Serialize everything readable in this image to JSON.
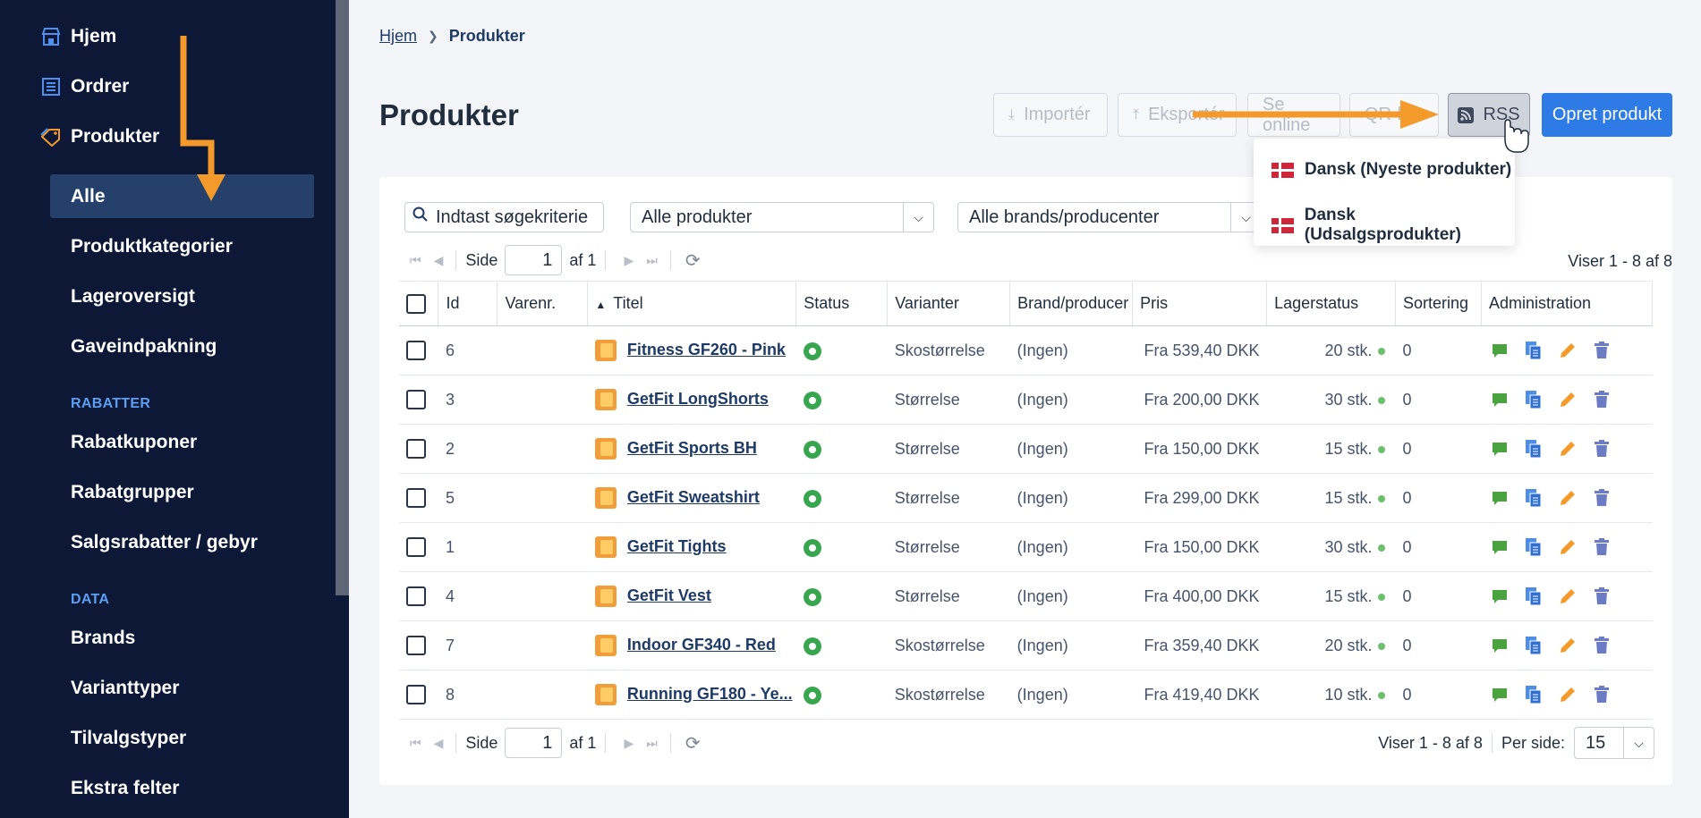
{
  "sidebar": {
    "top_items": [
      {
        "label": "Hjem",
        "icon": "store-icon"
      },
      {
        "label": "Ordrer",
        "icon": "list-icon"
      },
      {
        "label": "Produkter",
        "icon": "tag-icon"
      }
    ],
    "sub_items": [
      "Alle",
      "Produktkategorier",
      "Lageroversigt",
      "Gaveindpakning"
    ],
    "sections": [
      {
        "heading": "RABATTER",
        "items": [
          "Rabatkuponer",
          "Rabatgrupper",
          "Salgsrabatter / gebyr"
        ]
      },
      {
        "heading": "DATA",
        "items": [
          "Brands",
          "Varianttyper",
          "Tilvalgstyper",
          "Ekstra felter"
        ]
      }
    ],
    "active_item": "Alle"
  },
  "breadcrumb": {
    "home": "Hjem",
    "current": "Produkter"
  },
  "page_title": "Produkter",
  "toolbar": {
    "import": "Importér",
    "export": "Eksportér",
    "see_online": "Se online",
    "qr": "QR-k",
    "rss": "RSS",
    "create": "Opret produkt"
  },
  "rss_menu": [
    "Dansk (Nyeste produkter)",
    "Dansk (Udsalgsprodukter)"
  ],
  "filters": {
    "search_placeholder": "Indtast søgekriterie",
    "product_filter": "Alle produkter",
    "brand_filter": "Alle brands/producenter"
  },
  "pager": {
    "page_label": "Side",
    "page": "1",
    "of_label": "af 1",
    "showing": "Viser 1 - 8 af 8",
    "per_page_label": "Per side:",
    "per_page": "15"
  },
  "table": {
    "columns": [
      "Id",
      "Varenr.",
      "Titel",
      "Status",
      "Varianter",
      "Brand/producer",
      "Pris",
      "Lagerstatus",
      "Sortering",
      "Administration"
    ],
    "rows": [
      {
        "id": "6",
        "sku": "",
        "title": "Fitness GF260 - Pink",
        "variants": "Skostørrelse",
        "brand": "(Ingen)",
        "price": "Fra 539,40 DKK",
        "stock": "20 stk.",
        "sort": "0"
      },
      {
        "id": "3",
        "sku": "",
        "title": "GetFit LongShorts",
        "variants": "Størrelse",
        "brand": "(Ingen)",
        "price": "Fra 200,00 DKK",
        "stock": "30 stk.",
        "sort": "0"
      },
      {
        "id": "2",
        "sku": "",
        "title": "GetFit Sports BH",
        "variants": "Størrelse",
        "brand": "(Ingen)",
        "price": "Fra 150,00 DKK",
        "stock": "15 stk.",
        "sort": "0"
      },
      {
        "id": "5",
        "sku": "",
        "title": "GetFit Sweatshirt",
        "variants": "Størrelse",
        "brand": "(Ingen)",
        "price": "Fra 299,00 DKK",
        "stock": "15 stk.",
        "sort": "0"
      },
      {
        "id": "1",
        "sku": "",
        "title": "GetFit Tights",
        "variants": "Størrelse",
        "brand": "(Ingen)",
        "price": "Fra 150,00 DKK",
        "stock": "30 stk.",
        "sort": "0"
      },
      {
        "id": "4",
        "sku": "",
        "title": "GetFit Vest",
        "variants": "Størrelse",
        "brand": "(Ingen)",
        "price": "Fra 400,00 DKK",
        "stock": "15 stk.",
        "sort": "0"
      },
      {
        "id": "7",
        "sku": "",
        "title": "Indoor GF340 - Red",
        "variants": "Skostørrelse",
        "brand": "(Ingen)",
        "price": "Fra 359,40 DKK",
        "stock": "20 stk.",
        "sort": "0"
      },
      {
        "id": "8",
        "sku": "",
        "title": "Running GF180 - Ye...",
        "variants": "Skostørrelse",
        "brand": "(Ingen)",
        "price": "Fra 419,40 DKK",
        "stock": "10 stk.",
        "sort": "0"
      }
    ]
  },
  "colors": {
    "sidebar_bg": "#0c1836",
    "active_bg": "#24406b",
    "primary": "#2f7be6",
    "annotation_arrow": "#f39a2b",
    "status_green": "#38a54f"
  }
}
